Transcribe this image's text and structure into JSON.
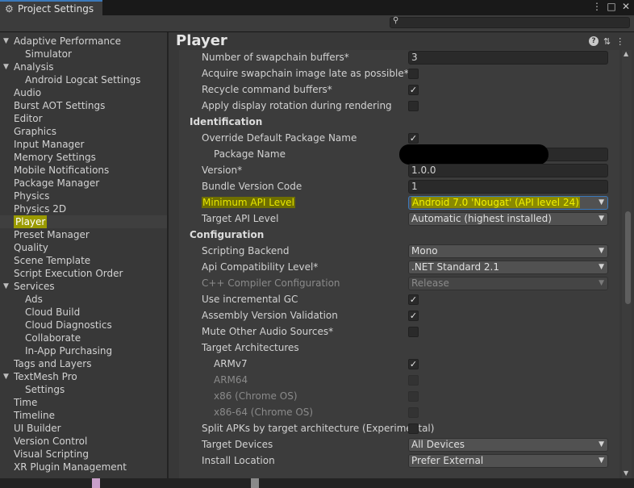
{
  "window": {
    "tab_title": "Project Settings",
    "tab_icon": "gear-icon",
    "controls": [
      "⋮",
      "□",
      "✕"
    ]
  },
  "search": {
    "placeholder": "",
    "icon": "search-icon"
  },
  "sidebar": {
    "items": [
      {
        "label": "Adaptive Performance",
        "indent": 0,
        "arrow": "▼"
      },
      {
        "label": "Simulator",
        "indent": 1
      },
      {
        "label": "Analysis",
        "indent": 0,
        "arrow": "▼"
      },
      {
        "label": "Android Logcat Settings",
        "indent": 1
      },
      {
        "label": "Audio",
        "indent": 0
      },
      {
        "label": "Burst AOT Settings",
        "indent": 0
      },
      {
        "label": "Editor",
        "indent": 0
      },
      {
        "label": "Graphics",
        "indent": 0
      },
      {
        "label": "Input Manager",
        "indent": 0
      },
      {
        "label": "Memory Settings",
        "indent": 0
      },
      {
        "label": "Mobile Notifications",
        "indent": 0
      },
      {
        "label": "Package Manager",
        "indent": 0
      },
      {
        "label": "Physics",
        "indent": 0
      },
      {
        "label": "Physics 2D",
        "indent": 0
      },
      {
        "label": "Player",
        "indent": 0,
        "selected": true
      },
      {
        "label": "Preset Manager",
        "indent": 0
      },
      {
        "label": "Quality",
        "indent": 0
      },
      {
        "label": "Scene Template",
        "indent": 0
      },
      {
        "label": "Script Execution Order",
        "indent": 0
      },
      {
        "label": "Services",
        "indent": 0,
        "arrow": "▼"
      },
      {
        "label": "Ads",
        "indent": 1
      },
      {
        "label": "Cloud Build",
        "indent": 1
      },
      {
        "label": "Cloud Diagnostics",
        "indent": 1
      },
      {
        "label": "Collaborate",
        "indent": 1
      },
      {
        "label": "In-App Purchasing",
        "indent": 1
      },
      {
        "label": "Tags and Layers",
        "indent": 0
      },
      {
        "label": "TextMesh Pro",
        "indent": 0,
        "arrow": "▼"
      },
      {
        "label": "Settings",
        "indent": 1
      },
      {
        "label": "Time",
        "indent": 0
      },
      {
        "label": "Timeline",
        "indent": 0
      },
      {
        "label": "UI Builder",
        "indent": 0
      },
      {
        "label": "Version Control",
        "indent": 0
      },
      {
        "label": "Visual Scripting",
        "indent": 0
      },
      {
        "label": "XR Plugin Management",
        "indent": 0
      }
    ]
  },
  "header": {
    "title": "Player",
    "icons": [
      "help-icon",
      "preset-icon",
      "more-icon"
    ]
  },
  "rows": [
    {
      "label": "Number of swapchain buffers*",
      "level": 1,
      "kind": "field",
      "value": "3"
    },
    {
      "label": "Acquire swapchain image late as possible*",
      "level": 1,
      "kind": "check",
      "checked": false
    },
    {
      "label": "Recycle command buffers*",
      "level": 1,
      "kind": "check",
      "checked": true
    },
    {
      "label": "Apply display rotation during rendering",
      "level": 1,
      "kind": "check",
      "checked": false
    },
    {
      "label": "Identification",
      "level": 0,
      "kind": "section"
    },
    {
      "label": "Override Default Package Name",
      "level": 1,
      "kind": "check",
      "checked": true
    },
    {
      "label": "Package Name",
      "level": 2,
      "kind": "redacted",
      "value": ""
    },
    {
      "label": "Version*",
      "level": 1,
      "kind": "field",
      "value": "1.0.0"
    },
    {
      "label": "Bundle Version Code",
      "level": 1,
      "kind": "field",
      "value": "1"
    },
    {
      "label": "Minimum API Level",
      "level": 1,
      "kind": "dropdown",
      "value": "Android 7.0 'Nougat' (API level 24)",
      "highlight": true
    },
    {
      "label": "Target API Level",
      "level": 1,
      "kind": "dropdown",
      "value": "Automatic (highest installed)"
    },
    {
      "label": "Configuration",
      "level": 0,
      "kind": "section"
    },
    {
      "label": "Scripting Backend",
      "level": 1,
      "kind": "dropdown",
      "value": "Mono"
    },
    {
      "label": "Api Compatibility Level*",
      "level": 1,
      "kind": "dropdown",
      "value": ".NET Standard 2.1"
    },
    {
      "label": "C++ Compiler Configuration",
      "level": 1,
      "kind": "dropdown",
      "value": "Release",
      "disabled": true
    },
    {
      "label": "Use incremental GC",
      "level": 1,
      "kind": "check",
      "checked": true
    },
    {
      "label": "Assembly Version Validation",
      "level": 1,
      "kind": "check",
      "checked": true
    },
    {
      "label": "Mute Other Audio Sources*",
      "level": 1,
      "kind": "check",
      "checked": false
    },
    {
      "label": "Target Architectures",
      "level": 1,
      "kind": "label"
    },
    {
      "label": "ARMv7",
      "level": 2,
      "kind": "check",
      "checked": true
    },
    {
      "label": "ARM64",
      "level": 2,
      "kind": "check",
      "checked": false,
      "disabled": true
    },
    {
      "label": "x86 (Chrome OS)",
      "level": 2,
      "kind": "check",
      "checked": false,
      "disabled": true
    },
    {
      "label": "x86-64 (Chrome OS)",
      "level": 2,
      "kind": "check",
      "checked": false,
      "disabled": true
    },
    {
      "label": "Split APKs by target architecture (Experimental)",
      "level": 1,
      "kind": "check",
      "checked": false
    },
    {
      "label": "Target Devices",
      "level": 1,
      "kind": "dropdown",
      "value": "All Devices"
    },
    {
      "label": "Install Location",
      "level": 1,
      "kind": "dropdown",
      "value": "Prefer External"
    }
  ],
  "colors": {
    "accent": "#3a79bb",
    "highlight": "#9a9a00",
    "panel": "#383838",
    "inspector": "#3c3c3c"
  }
}
